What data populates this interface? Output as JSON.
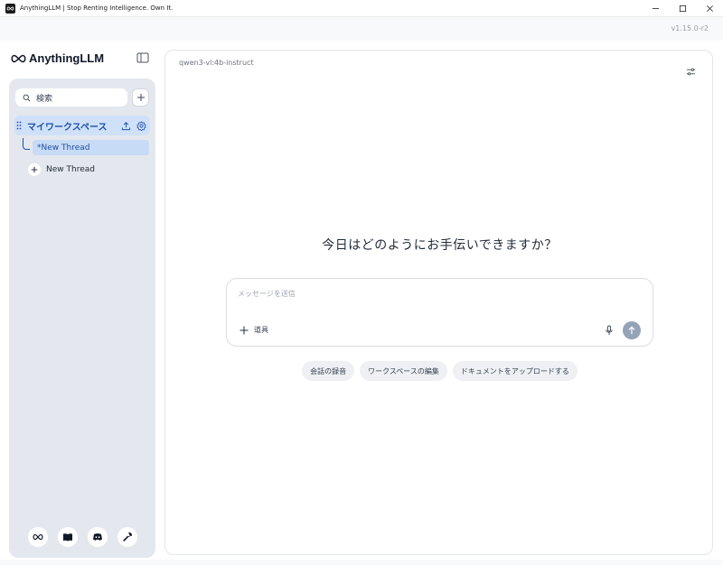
{
  "window": {
    "title": "AnythingLLM | Stop Renting Intelligence. Own It.",
    "minimize_icon": "minimize-icon",
    "maximize_icon": "maximize-icon",
    "close_icon": "close-icon"
  },
  "version": "v1.15.0-r2",
  "sidebar": {
    "brand": "AnythingLLM",
    "search_placeholder": "検索",
    "workspace": {
      "name": "マイワークスペース",
      "threads": [
        {
          "label": "*New Thread",
          "active": true
        }
      ],
      "new_thread_label": "New Thread"
    },
    "footer_icons": [
      "anythingllm-icon",
      "book-icon",
      "discord-icon",
      "wrench-icon"
    ]
  },
  "main": {
    "model": "qwen3-vl:4b-instruct",
    "greeting": "今日はどのようにお手伝いできますか？",
    "composer": {
      "placeholder": "メッセージを送信",
      "tools_label": "道具"
    },
    "suggestions": [
      "会話の録音",
      "ワークスペースの編集",
      "ドキュメントをアップロードする"
    ]
  },
  "colors": {
    "accent": "#1f4fa8",
    "sidebar_bg": "#e4e8ee",
    "selected_bg": "#cfe1f8",
    "send_button": "#94a3b8"
  }
}
